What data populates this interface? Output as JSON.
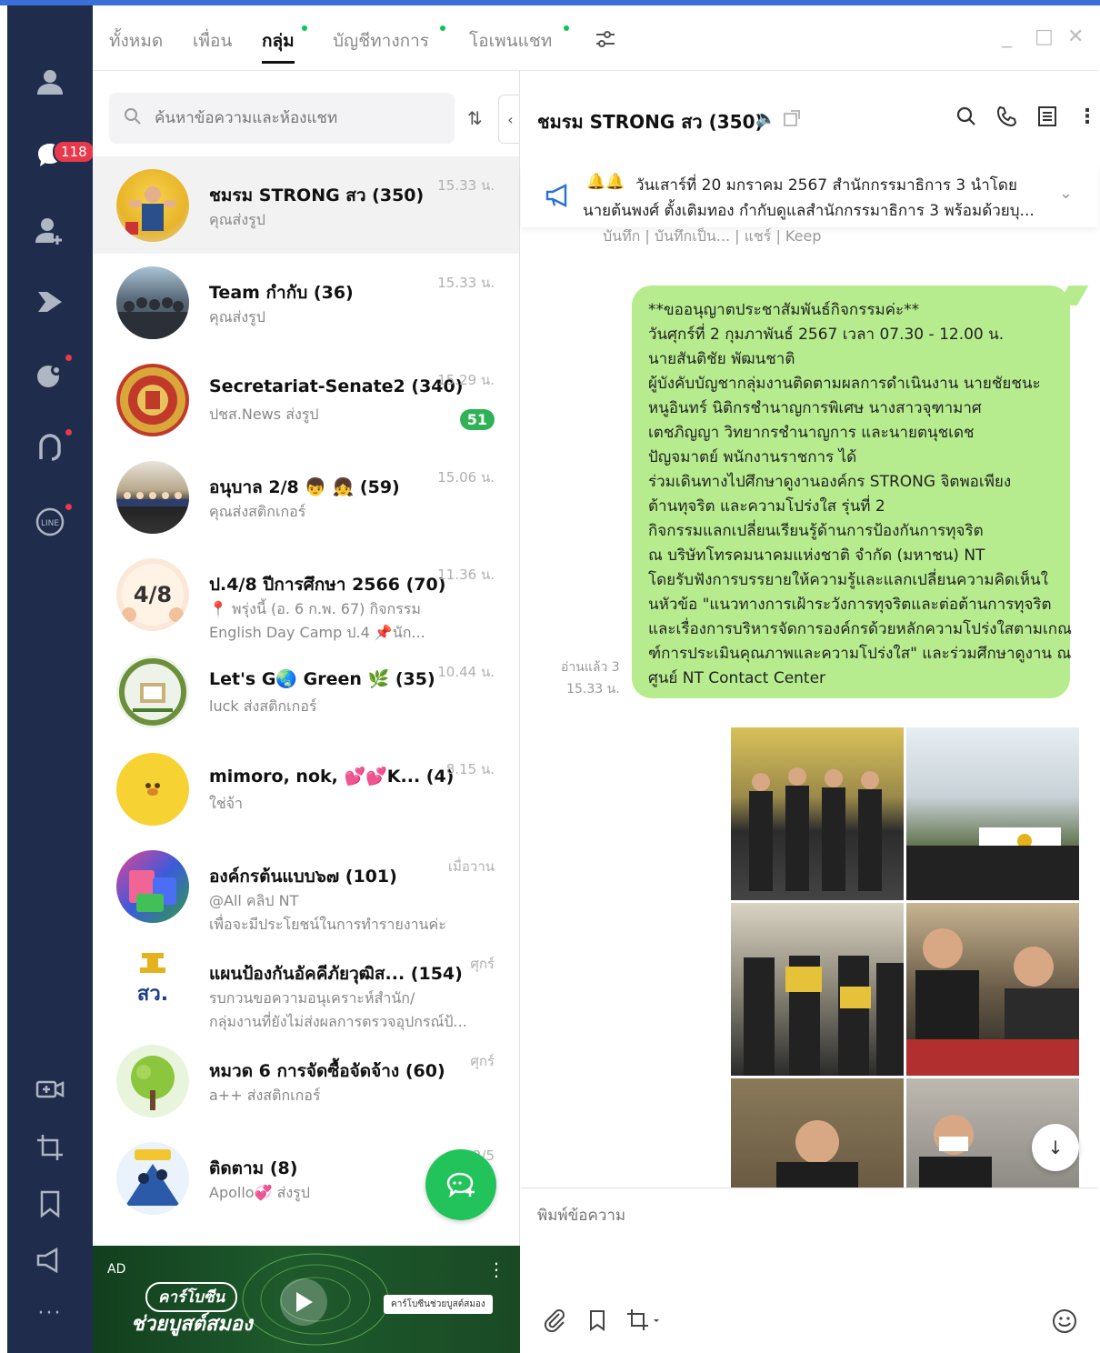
{
  "rail": {
    "badge": "118"
  },
  "tabs": [
    {
      "label": "ทั้งหมด"
    },
    {
      "label": "เพื่อน"
    },
    {
      "label": "กลุ่ม"
    },
    {
      "label": "บัญชีทางการ"
    },
    {
      "label": "โอเพนแชท"
    }
  ],
  "window": {
    "minimize": "_",
    "maximize": "□",
    "close": "✕"
  },
  "search": {
    "placeholder": "ค้นหาข้อความและห้องแชท"
  },
  "chats": [
    {
      "name": "ชมรม STRONG สว (350)",
      "sub": "คุณส่งรูป",
      "time": "15.33 น."
    },
    {
      "name": "Team กำกับ (36)",
      "sub": "คุณส่งรูป",
      "time": "15.33 น."
    },
    {
      "name": "Secretariat-Senate2 (340)",
      "sub": "ปชส.News ส่งรูป",
      "time": "15.29 น.",
      "unread": "51"
    },
    {
      "name": "อนุบาล 2/8 👦 👧 (59)",
      "sub": "คุณส่งสติกเกอร์",
      "time": "15.06 น."
    },
    {
      "name": "ป.4/8 ปีการศึกษา 2566 (70)",
      "sub": "📍 พรุ่งนี้ (อ. 6 ก.พ. 67) กิจกรรม",
      "sub2": "English Day Camp  ป.4 📌นัก...",
      "time": "11.36 น."
    },
    {
      "name": "Let's G🌏 Green 🌿 (35)",
      "sub": "luck ส่งสติกเกอร์",
      "time": "10.44 น."
    },
    {
      "name": "mimoro, nok, 💕💕K... (4)",
      "sub": "ใช่จ้า",
      "time": "8.15 น."
    },
    {
      "name": "องค์กรต้นแบบ๖๗ (101)",
      "sub": "@All  คลิป NT",
      "sub2": "เพื่อจะมีประโยชน์ในการทำรายงานค่ะ",
      "time": "เมื่อวาน"
    },
    {
      "name": "แผนป้องกันอัคคีภัยวุฒิส... (154)",
      "sub": "รบกวนขอความอนุเคราะห์สำนัก/",
      "sub2": "กลุ่มงานที่ยังไม่ส่งผลการตรวจอุปกรณ์ป้...",
      "time": "ศุกร์"
    },
    {
      "name": "หมวด 6 การจัดซื้อจัดจ้าง (60)",
      "sub": "a++ ส่งสติกเกอร์",
      "time": "ศุกร์"
    },
    {
      "name": "ติดตาม (8)",
      "sub": "Apollo💞 ส่งรูป",
      "time": "2/5"
    }
  ],
  "ad": {
    "label": "AD",
    "line1": "คาร์โบซีน",
    "line2": "ช่วยบูสต์สมอง",
    "search_text": "คาร์โบซีนช่วยบูสต์สมอง"
  },
  "chat": {
    "title": "ชมรม STRONG สว (350)",
    "announce_line1": "วันเสาร์ที่ 20 มกราคม 2567 สำนักกรรมาธิการ 3 นำโดย",
    "announce_line2": "นายต้นพงศ์ ตั้งเติมทอง กำกับดูแลสำนักกรรมาธิการ 3 พร้อมด้วยบุ...",
    "peek": "บันทึก  |  บันทึกเป็น...  |  แชร์  |  Keep",
    "message_lines": [
      "**ขออนุญาตประชาสัมพันธ์กิจกรรมค่ะ**",
      "วันศุกร์ที่ 2 กุมภาพันธ์ 2567 เวลา 07.30 - 12.00 น.",
      "นายสันติชัย  พัฒนชาติ",
      "ผู้บังคับบัญชากลุ่มงานติดตามผลการดำเนินงาน นายชัยชนะ",
      "หนูอินทร์ นิติกรชำนาญการพิเศษ นางสาวจุฑามาศ",
      "เตชภิญญา วิทยากรชำนาญการ และนายตนุชเดช",
      "ปัญจมาตย์ พนักงานราชการ ได้",
      "ร่วมเดินทางไปศึกษาดูงานองค์กร STRONG  จิตพอเพียง",
      "ต้านทุจริต และความโปร่งใส รุ่นที่ 2",
      "กิจกรรมแลกเปลี่ยนเรียนรู้ด้านการป้องกันการทุจริต",
      "ณ บริษัทโทรคมนาคมแห่งชาติ จำกัด (มหาชน) NT",
      "   โดยรับฟังการบรรยายให้ความรู้และแลกเปลี่ยนความคิดเห็นใ",
      "นหัวข้อ \"แนวทางการเฝ้าระวังการทุจริตและต่อต้านการทุจริต",
      "และเรื่องการบริหารจัดการองค์กรด้วยหลักความโปร่งใสตามเกณ",
      "ฑ์การประเมินคุณภาพและความโปร่งใส\" และร่วมศึกษาดูงาน ณ",
      "ศูนย์ NT Contact Center"
    ],
    "read_label": "อ่านแล้ว 3",
    "time": "15.33 น.",
    "compose_placeholder": "พิมพ์ข้อความ"
  },
  "colors": {
    "rail": "#1f2c4b",
    "bubble": "#b6ec8e",
    "accent": "#06c755",
    "badge": "#e8384c"
  }
}
